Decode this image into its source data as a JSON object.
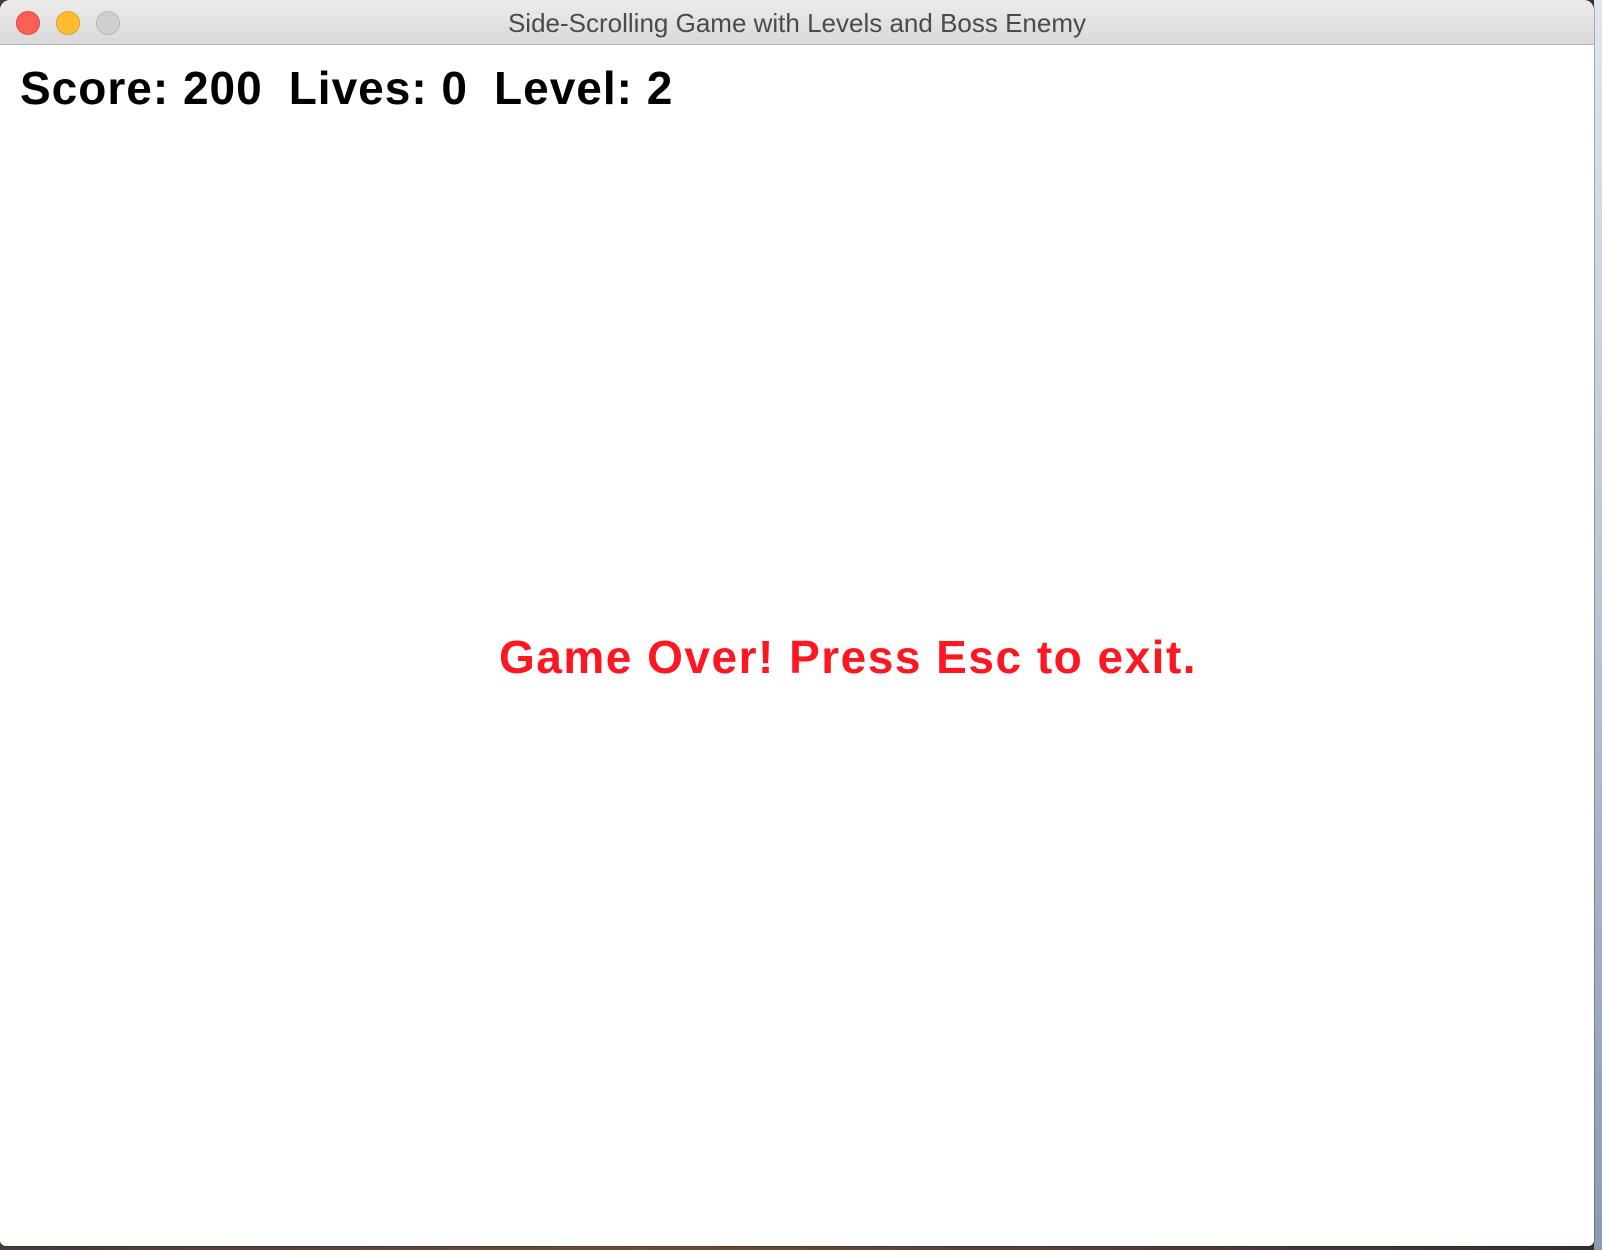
{
  "window": {
    "title": "Side-Scrolling Game with Levels and Boss Enemy"
  },
  "hud": {
    "score": "Score: 200",
    "lives": "Lives: 0",
    "level": "Level: 2"
  },
  "message": {
    "game_over": "Game Over! Press Esc to exit."
  },
  "colors": {
    "hud_text": "#000000",
    "game_over_text": "#fe1621",
    "canvas_background": "#ffffff"
  }
}
